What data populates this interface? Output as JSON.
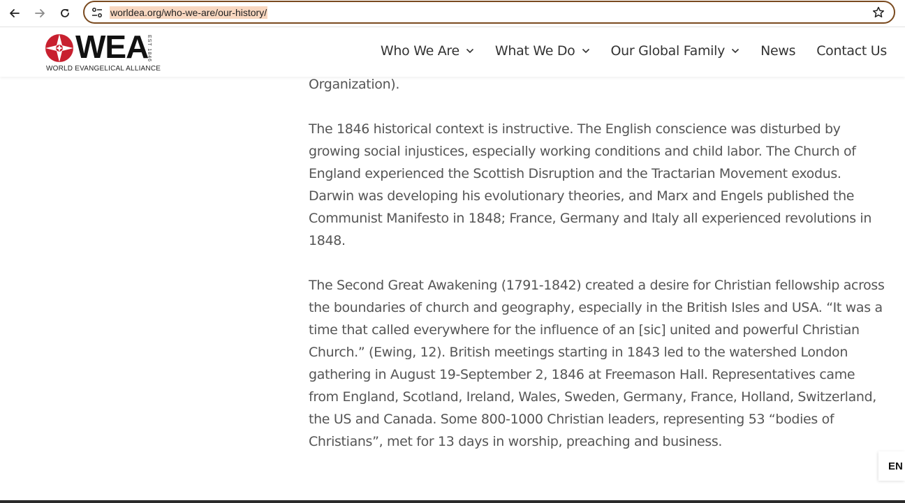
{
  "browser": {
    "url": "worldea.org/who-we-are/our-history/"
  },
  "header": {
    "logo_word": "WEA",
    "logo_est": "EST 1846",
    "logo_subtitle": "WORLD EVANGELICAL ALLIANCE",
    "nav": [
      {
        "label": "Who We Are",
        "has_dropdown": true
      },
      {
        "label": "What We Do",
        "has_dropdown": true
      },
      {
        "label": "Our Global Family",
        "has_dropdown": true
      },
      {
        "label": "News",
        "has_dropdown": false
      },
      {
        "label": "Contact Us",
        "has_dropdown": false
      }
    ]
  },
  "content": {
    "paragraphs": [
      "Organization).",
      "The 1846 historical context is instructive. The English conscience was disturbed by growing social injustices, especially working conditions and child labor. The Church of England experienced the Scottish Disruption and the Tractarian Movement exodus. Darwin was developing his evolutionary theories, and Marx and Engels published the Communist Manifesto in 1848; France, Germany and Italy all experienced revolutions in 1848.",
      "The Second Great Awakening (1791-1842) created a desire for Christian fellowship across the boundaries of church and geography, especially in the British Isles and USA. “It was a time that called everywhere for the influence of an [sic] united and powerful Christian Church.” (Ewing, 12). British meetings starting in 1843 led to the watershed London gathering in August 19-September 2, 1846 at Freemason Hall. Representatives came from England, Scotland, Ireland, Wales, Sweden, Germany, France, Holland, Switzerland, the US and Canada. Some 800-1000 Christian leaders, representing 53 “bodies of Christians”, met for 13 days in worship, preaching and business."
    ]
  },
  "language": {
    "label": "EN"
  },
  "colors": {
    "logo_red": "#c8202f",
    "omnibox_border": "#7a4a1f",
    "url_highlight": "#f8d7c0",
    "body_text": "#555555"
  }
}
